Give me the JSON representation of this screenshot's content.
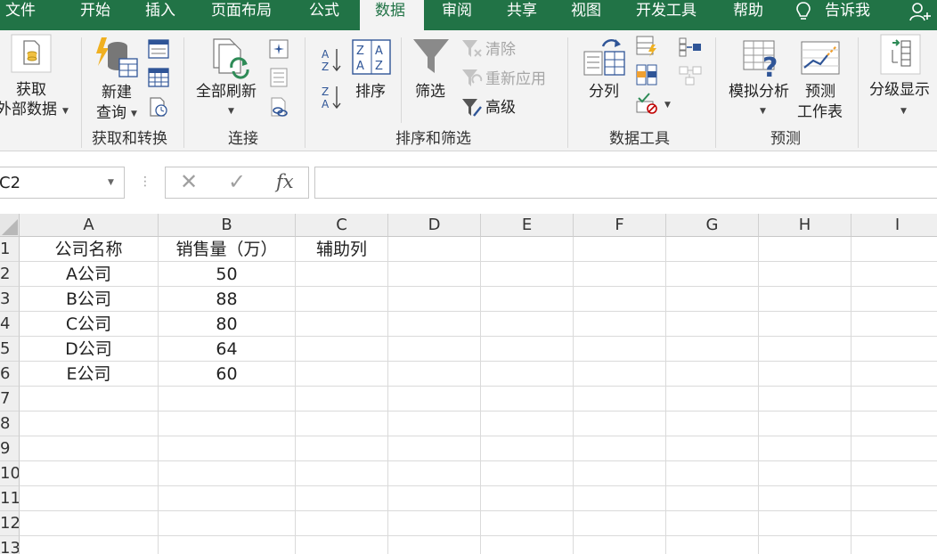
{
  "tabs": [
    {
      "label": "文件",
      "active": false
    },
    {
      "label": "开始",
      "active": false
    },
    {
      "label": "插入",
      "active": false
    },
    {
      "label": "页面布局",
      "active": false
    },
    {
      "label": "公式",
      "active": false
    },
    {
      "label": "数据",
      "active": true
    },
    {
      "label": "审阅",
      "active": false
    },
    {
      "label": "共享",
      "active": false
    },
    {
      "label": "视图",
      "active": false
    },
    {
      "label": "开发工具",
      "active": false
    },
    {
      "label": "帮助",
      "active": false
    }
  ],
  "tell_me": {
    "label": "告诉我",
    "icon": "lightbulb-icon"
  },
  "account_icon": "add-person-icon",
  "ribbon": {
    "get_external": {
      "line1": "获取",
      "line2": "外部数据"
    },
    "new_query": {
      "line1": "新建",
      "line2": "查询"
    },
    "group_get_transform": "获取和转换",
    "refresh_all": "全部刷新",
    "group_connections": "连接",
    "sort": "排序",
    "filter": "筛选",
    "clear": "清除",
    "reapply": "重新应用",
    "advanced": "高级",
    "group_sort_filter": "排序和筛选",
    "text_to_columns": "分列",
    "group_data_tools": "数据工具",
    "what_if": "模拟分析",
    "forecast_sheet": {
      "line1": "预测",
      "line2": "工作表"
    },
    "group_forecast": "预测",
    "outline": "分级显示"
  },
  "formula_bar": {
    "name_box": "C2",
    "cancel_glyph": "✕",
    "enter_glyph": "✓",
    "fx_label": "fx",
    "formula": ""
  },
  "grid": {
    "columns": [
      "A",
      "B",
      "C",
      "D",
      "E",
      "F",
      "G",
      "H",
      "I"
    ],
    "rows": [
      "1",
      "2",
      "3",
      "4",
      "5",
      "6",
      "7",
      "8",
      "9",
      "10",
      "11",
      "12",
      "13"
    ],
    "header_row": {
      "a": "公司名称",
      "b": "销售量（万）",
      "c": "辅助列"
    },
    "data": [
      {
        "company": "A公司",
        "sales": "50"
      },
      {
        "company": "B公司",
        "sales": "88"
      },
      {
        "company": "C公司",
        "sales": "80"
      },
      {
        "company": "D公司",
        "sales": "64"
      },
      {
        "company": "E公司",
        "sales": "60"
      }
    ]
  },
  "colors": {
    "excel_green": "#217346",
    "ribbon_bg": "#f3f3f3",
    "grid_line": "#dadada"
  }
}
